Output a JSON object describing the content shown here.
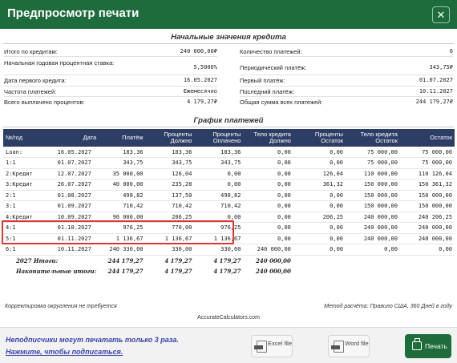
{
  "window": {
    "title": "Предпросмотр печати",
    "close_glyph": "✕",
    "close_icon": "close-icon"
  },
  "summary": {
    "title": "Начальные значения кредита",
    "left": [
      {
        "label": "Итого по кредитам:",
        "value": "240 000,00₽"
      },
      {
        "label": "Начальная годовая процентная ставка:",
        "value": "5,5000%"
      },
      {
        "label": "Дата первого кредита:",
        "value": "16.05.2027"
      },
      {
        "label": "Частота платежей:",
        "value": "Ежемесячно"
      },
      {
        "label": "Всего выплачено процентов:",
        "value": "4 179,27₽"
      }
    ],
    "right": [
      {
        "label": "Количество платежей:",
        "value": "6"
      },
      {
        "label": "Периодический платёж:",
        "value": "343,75₽"
      },
      {
        "label": "Первый платёж:",
        "value": "01.07.2027"
      },
      {
        "label": "Последний платёж:",
        "value": "10.11.2027"
      },
      {
        "label": "Общая сумма всех платежей:",
        "value": "244 179,27₽"
      }
    ]
  },
  "schedule": {
    "title": "График платежей",
    "headers": [
      "№/год",
      "Дата",
      "Платёж",
      "Проценты Должно",
      "Проценты Оплачено",
      "Тело кредита Должно",
      "Проценты Остаток",
      "Тело кредита Остаток",
      "Остаток"
    ],
    "rows": [
      [
        "Loan:",
        "16.05.2027",
        "183,36",
        "183,36",
        "183,36",
        "0,00",
        "0,00",
        "75 000,00",
        "75 000,00"
      ],
      [
        "1:1",
        "01.07.2027",
        "343,75",
        "343,75",
        "343,75",
        "0,00",
        "0,00",
        "75 000,00",
        "75 000,00"
      ],
      [
        "2:Кредит",
        "12.07.2027",
        "35 000,00",
        "126,04",
        "0,00",
        "0,00",
        "126,04",
        "110 000,00",
        "110 126,04"
      ],
      [
        "3:Кредит",
        "26.07.2027",
        "40 000,00",
        "235,28",
        "0,00",
        "0,00",
        "361,32",
        "150 000,00",
        "150 361,32"
      ],
      [
        "2:1",
        "01.08.2027",
        "498,82",
        "137,50",
        "498,82",
        "0,00",
        "0,00",
        "150 000,00",
        "150 000,00"
      ],
      [
        "3:1",
        "01.09.2027",
        "710,42",
        "710,42",
        "710,42",
        "0,00",
        "0,00",
        "150 000,00",
        "150 000,00"
      ],
      [
        "4:Кредит",
        "10.09.2027",
        "90 000,00",
        "206,25",
        "0,00",
        "0,00",
        "206,25",
        "240 000,00",
        "240 206,25"
      ],
      [
        "4:1",
        "01.10.2027",
        "976,25",
        "770,00",
        "976,25",
        "0,00",
        "0,00",
        "240 000,00",
        "240 000,00"
      ],
      [
        "5:1",
        "01.11.2027",
        "1 136,67",
        "1 136,67",
        "1 136,67",
        "0,00",
        "0,00",
        "240 000,00",
        "240 000,00"
      ],
      [
        "6:1",
        "10.11.2027",
        "240 330,00",
        "330,00",
        "330,00",
        "240 000,00",
        "0,00",
        "0,00",
        "0,00"
      ]
    ],
    "totals": [
      {
        "label": "2027 Итоги:",
        "payment": "244 179,27",
        "int_due": "4 179,27",
        "int_paid": "4 179,27",
        "principal": "240 000,00"
      },
      {
        "label": "Накопительные итоги:",
        "payment": "244 179,27",
        "int_due": "4 179,27",
        "int_paid": "4 179,27",
        "principal": "240 000,00"
      }
    ]
  },
  "footer": {
    "rounding_note": "Корректировка округления не требуется",
    "method_note": "Метод расчёта: Правило США, 360 Дней в году",
    "site": "AccurateCalculators.com"
  },
  "bottom": {
    "notice": "Неподписчики могут печатать только 3 раза.",
    "subscribe_link": "Нажмите, чтобы подписаться.",
    "excel_label": "Excel file",
    "word_label": "Word file",
    "print_label": "Печать"
  }
}
